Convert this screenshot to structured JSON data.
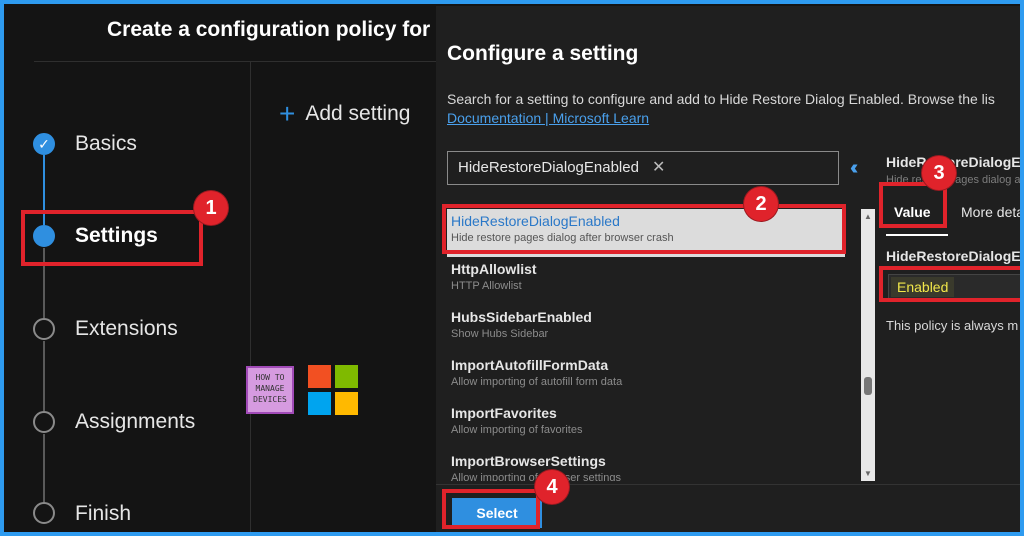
{
  "wizard": {
    "title": "Create a configuration policy for",
    "steps": [
      {
        "label": "Basics",
        "state": "done"
      },
      {
        "label": "Settings",
        "state": "active"
      },
      {
        "label": "Extensions",
        "state": "pending"
      },
      {
        "label": "Assignments",
        "state": "pending"
      },
      {
        "label": "Finish",
        "state": "pending"
      }
    ],
    "add_setting_label": "Add setting",
    "watermark_text": [
      "HOW TO",
      "MANAGE",
      "DEVICES"
    ]
  },
  "panel": {
    "title": "Configure a setting",
    "description": "Search for a setting to configure and add to Hide Restore Dialog Enabled. Browse the lis",
    "link_text": "Documentation | Microsoft Learn",
    "search": {
      "value": "HideRestoreDialogEnabled",
      "clear_icon": "close-icon"
    },
    "collapse_icon": "double-chevron-left-icon",
    "results": [
      {
        "name": "HideRestoreDialogEnabled",
        "description": "Hide restore pages dialog after browser crash",
        "selected": true
      },
      {
        "name": "HttpAllowlist",
        "description": "HTTP Allowlist",
        "selected": false
      },
      {
        "name": "HubsSidebarEnabled",
        "description": "Show Hubs Sidebar",
        "selected": false
      },
      {
        "name": "ImportAutofillFormData",
        "description": "Allow importing of autofill form data",
        "selected": false
      },
      {
        "name": "ImportFavorites",
        "description": "Allow importing of favorites",
        "selected": false
      },
      {
        "name": "ImportBrowserSettings",
        "description": "Allow importing of browser settings",
        "selected": false
      }
    ],
    "select_button": "Select",
    "details": {
      "heading": "HideRestoreDialogEnabled",
      "subheading": "Hide restore pages dialog after browser crash",
      "tabs": [
        "Value",
        "More details"
      ],
      "field_label": "HideRestoreDialogEnabled",
      "value": "Enabled",
      "note": "This policy is always m"
    }
  },
  "callouts": [
    "1",
    "2",
    "3",
    "4"
  ],
  "colors": {
    "accent": "#2f8fe0",
    "callout": "#e0232b",
    "background": "#141414",
    "frame": "#2e9bf0"
  }
}
